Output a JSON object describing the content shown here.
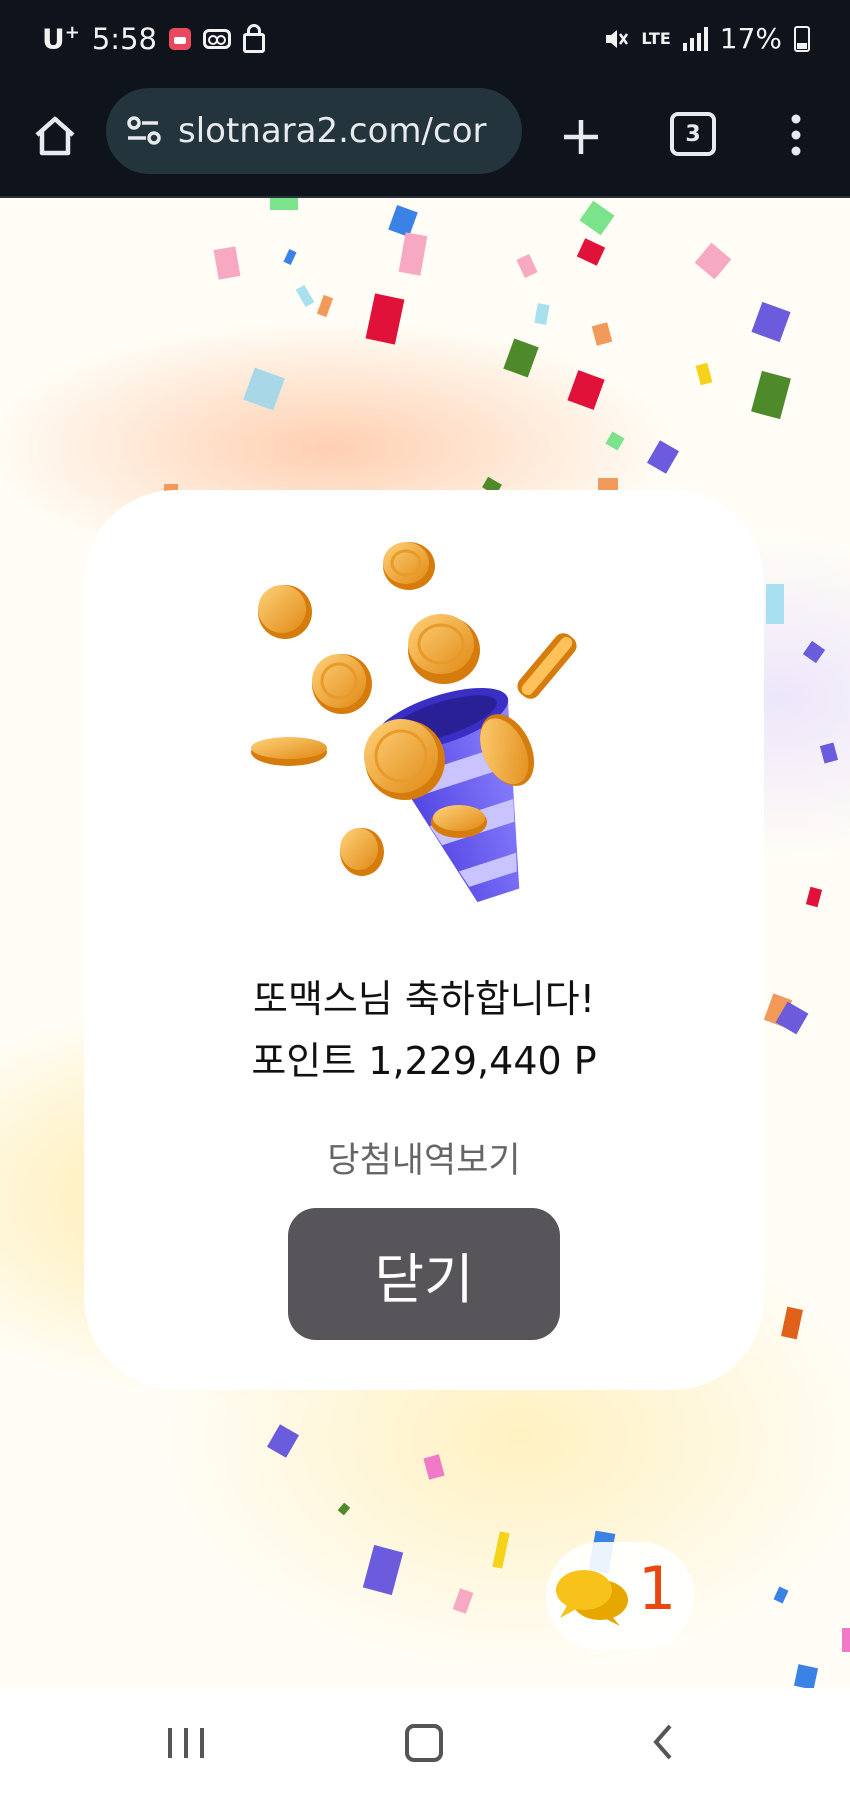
{
  "status_bar": {
    "carrier": "U",
    "carrier_sup": "+",
    "time": "5:58",
    "network": "LTE",
    "battery": "17%",
    "icons": [
      "calendar-icon",
      "voicemail-icon",
      "lock-icon",
      "mute-icon",
      "lte-icon",
      "signal-icon",
      "battery-icon"
    ]
  },
  "browser": {
    "url": "slotnara2.com/cor",
    "tab_count": "3",
    "icons": [
      "home-icon",
      "site-settings-icon",
      "plus-icon",
      "more-vert-icon"
    ]
  },
  "modal": {
    "congrats": "또맥스님 축하합니다!",
    "points": "포인트 1,229,440 P",
    "history_link": "당첨내역보기",
    "close_label": "닫기",
    "illustration": "coin-party-popper-icon"
  },
  "chat": {
    "count": "1",
    "icon": "chat-bubbles-icon",
    "count_color": "#e8470f"
  },
  "nav_bar": {
    "icons": [
      "recents-icon",
      "home-icon",
      "back-icon"
    ]
  },
  "colors": {
    "status_bg": "#0e131c",
    "url_bg": "#24343c",
    "close_button": "#57545a",
    "cone": "#6a5cff",
    "coin": "#f2a833"
  }
}
